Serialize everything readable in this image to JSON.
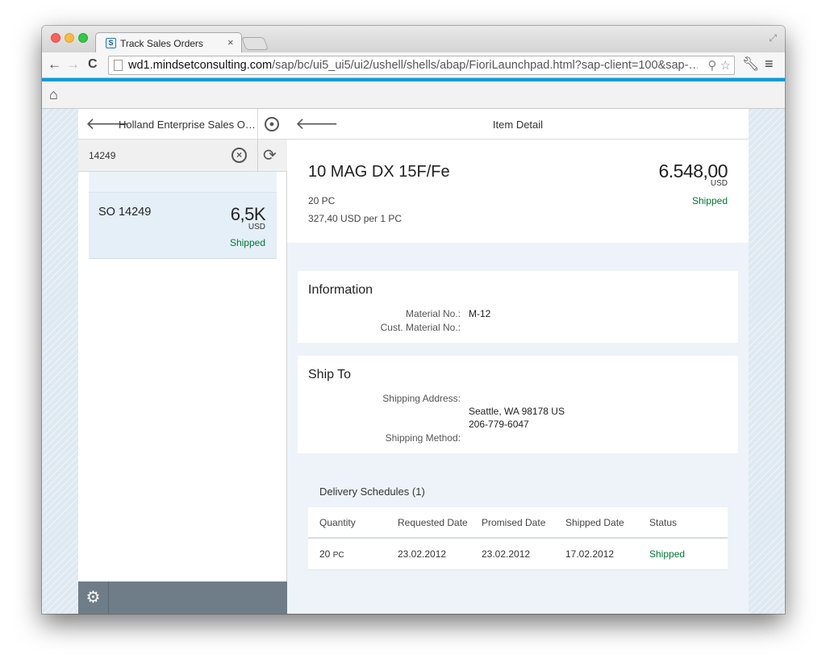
{
  "browser": {
    "tab_title": "Track Sales Orders",
    "tab_close": "×",
    "url_host": "wd1.mindsetconsulting.com",
    "url_path": "/sap/bc/ui5_ui5/ui2/ushell/shells/abap/FioriLaunchpad.html?sap-client=100&sap-…"
  },
  "master": {
    "title": "Holland Enterprise Sales Or…",
    "search_value": "14249",
    "list_items": [
      {
        "title": "SO 14249",
        "number": "6,5K",
        "unit": "USD",
        "status": "Shipped"
      }
    ]
  },
  "detail": {
    "title": "Item Detail",
    "object": {
      "title": "10 MAG DX 15F/Fe",
      "number": "6.548,00",
      "unit": "USD",
      "status": "Shipped",
      "quantity": "20 PC",
      "price": "327,40 USD per 1 PC"
    },
    "information": {
      "title": "Information",
      "material_label": "Material No.:",
      "material_value": "M-12",
      "cust_material_label": "Cust. Material No.:",
      "cust_material_value": ""
    },
    "ship_to": {
      "title": "Ship To",
      "address_label": "Shipping Address:",
      "address_line1": "Seattle, WA 98178 US",
      "address_line2": "206-779-6047",
      "method_label": "Shipping Method:",
      "method_value": ""
    },
    "delivery": {
      "title": "Delivery Schedules (1)",
      "columns": [
        "Quantity",
        "Requested Date",
        "Promised Date",
        "Shipped Date",
        "Status"
      ],
      "rows": [
        {
          "qty": "20",
          "qty_unit": "PC",
          "requested": "23.02.2012",
          "promised": "23.02.2012",
          "shipped": "17.02.2012",
          "status": "Shipped"
        }
      ]
    }
  },
  "colors": {
    "accent": "#009de0",
    "positive": "#007833",
    "footer": "#6f7d88"
  }
}
